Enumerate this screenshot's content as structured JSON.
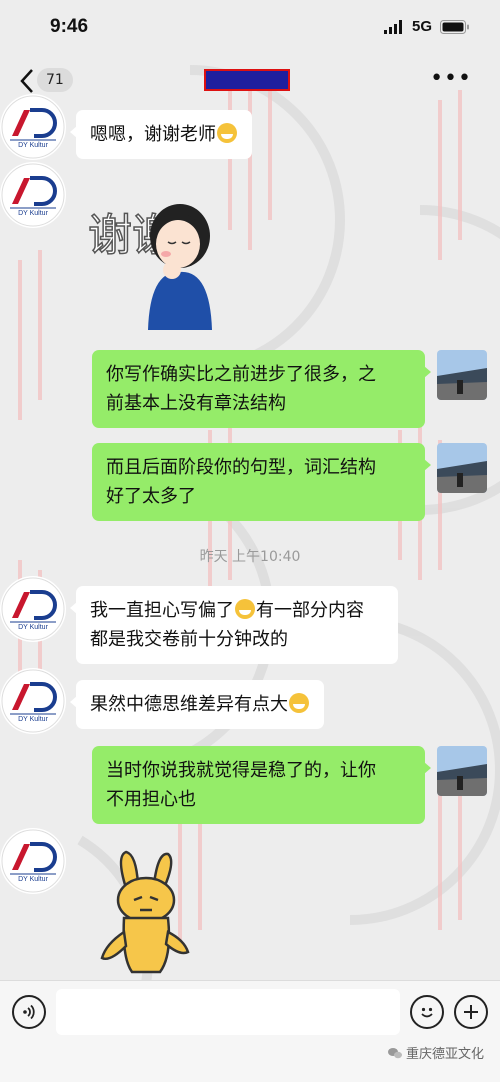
{
  "status_bar": {
    "time": "9:46",
    "network": "5G"
  },
  "nav": {
    "unread_count": "71"
  },
  "messages": [
    {
      "side": "left",
      "text": "嗯嗯，谢谢老师"
    },
    {
      "side": "left",
      "sticker": "谢谢"
    },
    {
      "side": "right",
      "line1": "你写作确实比之前进步了很多，之",
      "line2": "前基本上没有章法结构"
    },
    {
      "side": "right",
      "line1": "而且后面阶段你的句型，词汇结构",
      "line2": "好了太多了"
    },
    {
      "side": "left",
      "line1a": "我一直担心写偏了",
      "line1b": "有一部分内容",
      "line2": "都是我交卷前十分钟改的"
    },
    {
      "side": "left",
      "text": "果然中德思维差异有点大"
    },
    {
      "side": "right",
      "line1": "当时你说我就觉得是稳了的，让你",
      "line2": "不用担心也"
    }
  ],
  "timestamp": "昨天 上午10:40",
  "avatar_text": "DY Kultur",
  "footer": "重庆德亚文化",
  "colors": {
    "bubble_right": "#95ec69",
    "bubble_left": "#ffffff",
    "background": "#ededed"
  }
}
